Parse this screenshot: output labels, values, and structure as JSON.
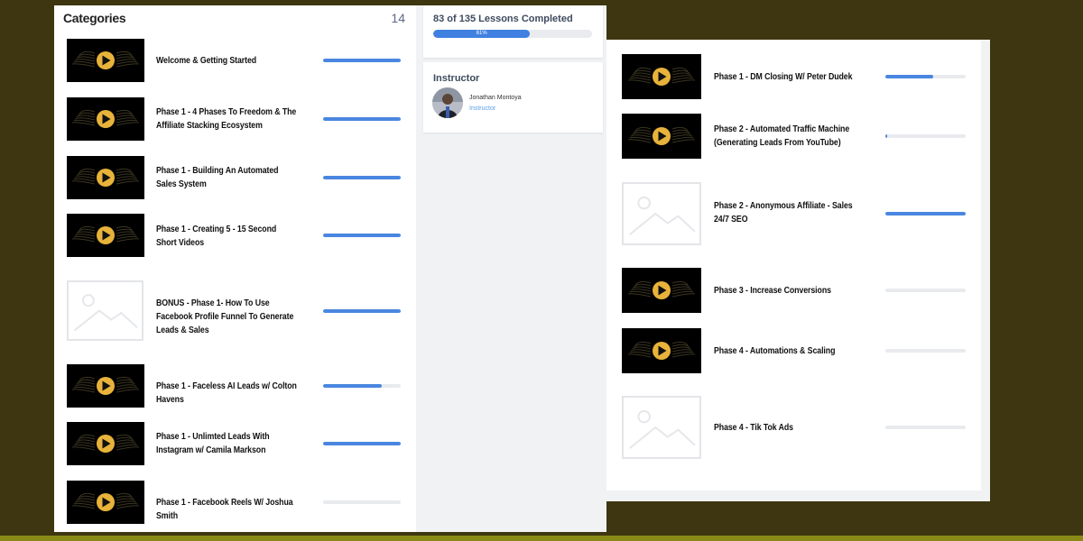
{
  "categories": {
    "title": "Categories",
    "count": "14",
    "lessons": [
      {
        "title": "Welcome & Getting Started",
        "progress": 1.0,
        "thumb": "video"
      },
      {
        "title": "Phase 1 - 4 Phases To Freedom & The Affiliate Stacking Ecosystem",
        "progress": 1.0,
        "thumb": "video"
      },
      {
        "title": "Phase 1 - Building An Automated Sales System",
        "progress": 1.0,
        "thumb": "video"
      },
      {
        "title": "Phase 1 - Creating 5 - 15 Second Short Videos",
        "progress": 1.0,
        "thumb": "video"
      },
      {
        "title": "BONUS - Phase 1- How To Use Facebook Profile Funnel To Generate Leads & Sales",
        "progress": 1.0,
        "thumb": "placeholder"
      },
      {
        "title": "Phase 1 - Faceless AI Leads w/ Colton Havens",
        "progress": 0.75,
        "thumb": "video"
      },
      {
        "title": "Phase 1 - Unlimted Leads With Instagram w/ Camila Markson",
        "progress": 1.0,
        "thumb": "video"
      },
      {
        "title": "Phase 1 - Facebook Reels W/ Joshua Smith",
        "progress": 0.0,
        "thumb": "video"
      }
    ]
  },
  "progress": {
    "summary": "83 of 135 Lessons Completed",
    "percent_label": "61%",
    "fraction": 0.61
  },
  "instructor": {
    "heading": "Instructor",
    "name": "Jonathan Montoya",
    "role": "Instructor"
  },
  "right_lessons": [
    {
      "title": "Phase 1 - DM Closing W/ Peter Dudek",
      "progress": 0.6,
      "thumb": "video"
    },
    {
      "title": "Phase 2 - Automated Traffic Machine (Generating Leads From YouTube)",
      "progress": 0.02,
      "thumb": "video"
    },
    {
      "title": "Phase 2 - Anonymous Affiliate - Sales 24/7 SEO",
      "progress": 1.0,
      "thumb": "placeholder"
    },
    {
      "title": "Phase 3 - Increase Conversions",
      "progress": 0.0,
      "thumb": "video"
    },
    {
      "title": "Phase 4 - Automations & Scaling",
      "progress": 0.0,
      "thumb": "video"
    },
    {
      "title": "Phase 4 - Tik Tok Ads",
      "progress": 0.0,
      "thumb": "placeholder"
    }
  ],
  "icons": {
    "video_thumb": "play-icon",
    "placeholder_thumb": "image-placeholder-icon"
  },
  "colors": {
    "accent": "#4a86e0",
    "play_gold": "#e8b33a"
  }
}
